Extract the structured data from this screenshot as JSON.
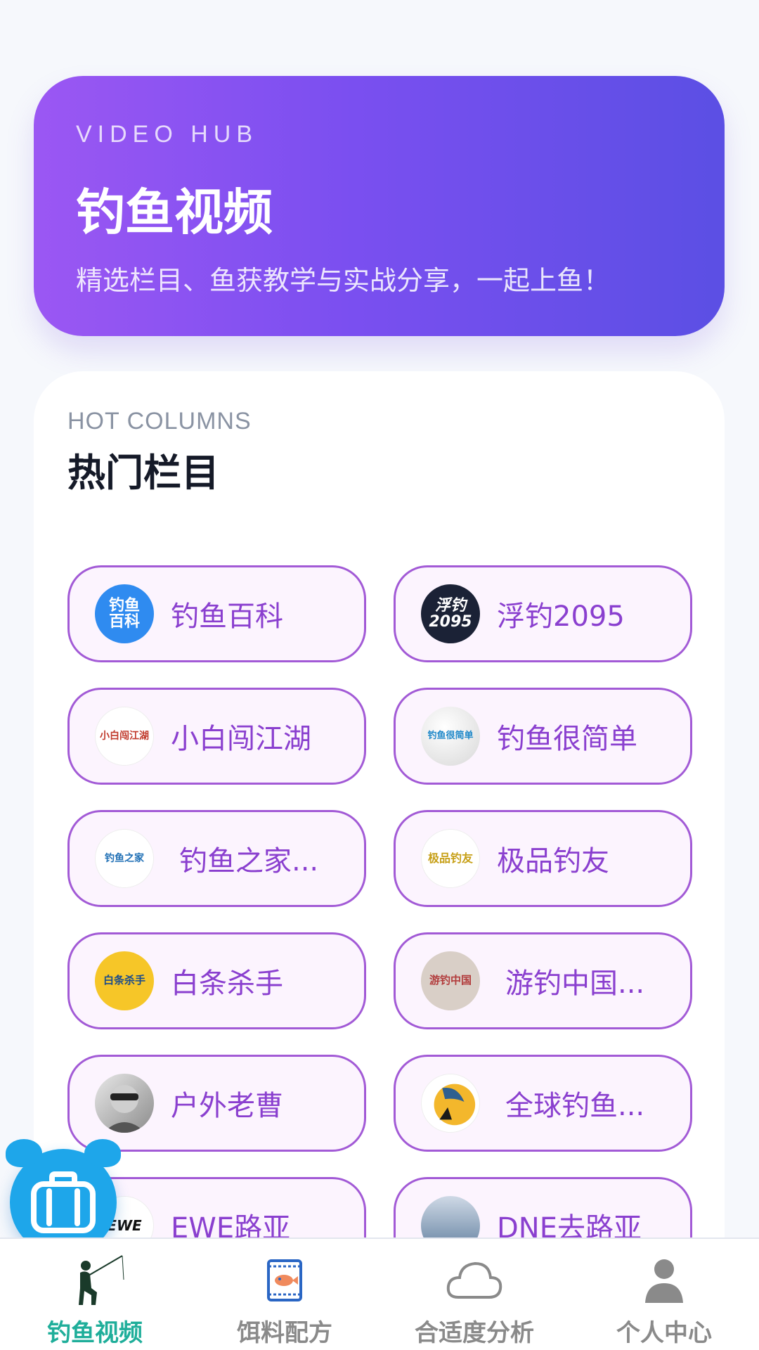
{
  "hero": {
    "eyebrow": "VIDEO HUB",
    "title": "钓鱼视频",
    "subtitle": "精选栏目、鱼获教学与实战分享，一起上鱼！"
  },
  "columns": {
    "eyebrow": "HOT COLUMNS",
    "title": "热门栏目",
    "items": [
      {
        "label": "钓鱼百科",
        "avatar_text": "钓鱼\n百科",
        "avatar_color": "#2f8bf0"
      },
      {
        "label": "浮钓2095",
        "avatar_text": "浮钓\n2095",
        "avatar_color": "#1b2236"
      },
      {
        "label": "小白闯江湖",
        "avatar_text": "小白闯江湖",
        "avatar_color": "#ffffff"
      },
      {
        "label": "钓鱼很简单",
        "avatar_text": "钓鱼很简单",
        "avatar_color": "#f2f2f2"
      },
      {
        "label": "钓鱼之家...",
        "avatar_text": "钓鱼之家",
        "avatar_color": "#ffffff"
      },
      {
        "label": "极品钓友",
        "avatar_text": "极品钓友",
        "avatar_color": "#ffffff"
      },
      {
        "label": "白条杀手",
        "avatar_text": "白条杀手",
        "avatar_color": "#f6c628"
      },
      {
        "label": "游钓中国...",
        "avatar_text": "游钓中国",
        "avatar_color": "#d9cfc7"
      },
      {
        "label": "户外老曹",
        "avatar_text": "",
        "avatar_color": "#b8b8b8"
      },
      {
        "label": "全球钓鱼...",
        "avatar_text": "",
        "avatar_color": "#ffffff"
      },
      {
        "label": "EWE路亚",
        "avatar_text": "EWE",
        "avatar_color": "#ffffff"
      },
      {
        "label": "DNE去路亚",
        "avatar_text": "",
        "avatar_color": "#6b8fb0"
      }
    ]
  },
  "nav": {
    "items": [
      {
        "label": "钓鱼视频",
        "icon": "fisherman-icon",
        "active": true
      },
      {
        "label": "饵料配方",
        "icon": "bait-bag-icon",
        "active": false
      },
      {
        "label": "合适度分析",
        "icon": "cloud-icon",
        "active": false
      },
      {
        "label": "个人中心",
        "icon": "person-icon",
        "active": false
      }
    ]
  },
  "colors": {
    "accent": "#8a3fcf",
    "chip_border": "#a25ad6",
    "nav_active": "#1fae9a",
    "fab": "#1ea6ea"
  }
}
